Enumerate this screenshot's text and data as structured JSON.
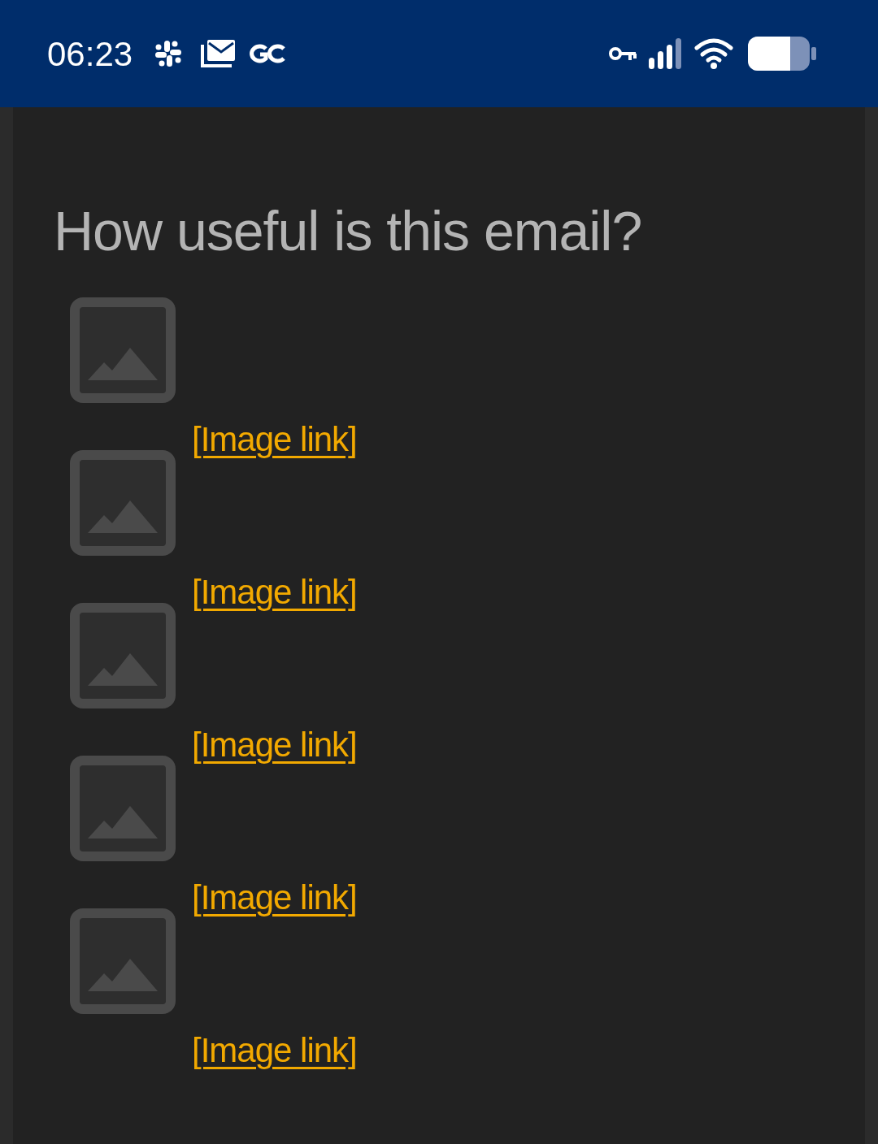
{
  "status_bar": {
    "time": "06:23"
  },
  "heading": "How useful is this email?",
  "items": [
    {
      "kind": "image_link",
      "label": "[Image link]"
    },
    {
      "kind": "image_link",
      "label": "[Image link]"
    },
    {
      "kind": "image_link",
      "label": "[Image link]"
    },
    {
      "kind": "image_link",
      "label": "[Image link]"
    },
    {
      "kind": "image_link",
      "label": "[Image link]"
    }
  ]
}
